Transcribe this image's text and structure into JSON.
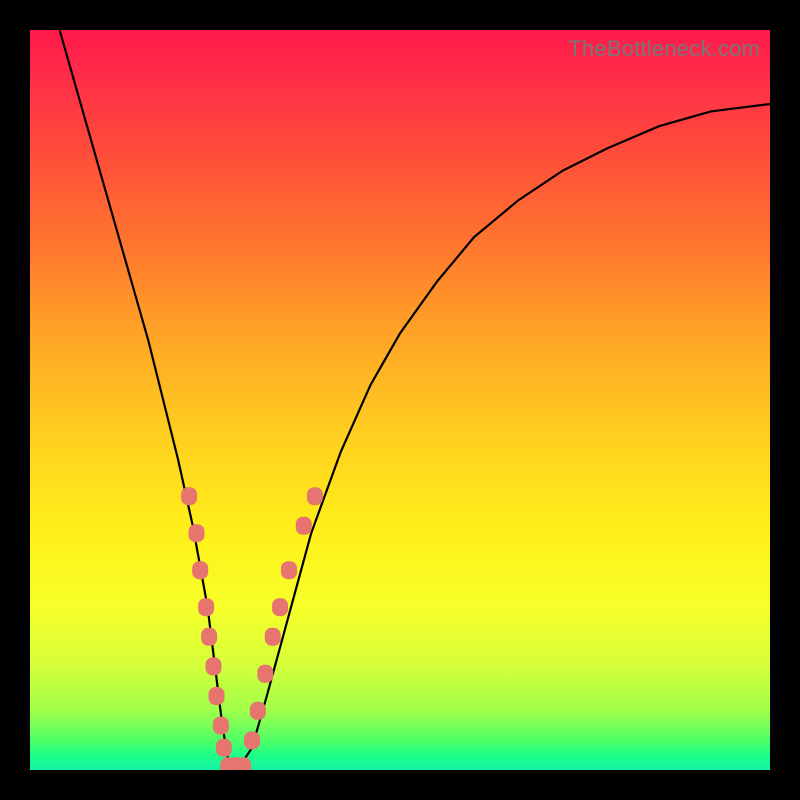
{
  "watermark": "TheBottleneck.com",
  "chart_data": {
    "type": "line",
    "title": "",
    "xlabel": "",
    "ylabel": "",
    "xlim": [
      0,
      100
    ],
    "ylim": [
      0,
      100
    ],
    "grid": false,
    "legend": false,
    "background_gradient": {
      "direction": "top-to-bottom",
      "stops": [
        {
          "pos": 0,
          "color": "#ff1a4b"
        },
        {
          "pos": 18,
          "color": "#ff5138"
        },
        {
          "pos": 42,
          "color": "#ffa726"
        },
        {
          "pos": 68,
          "color": "#fff01a"
        },
        {
          "pos": 86,
          "color": "#d4ff3a"
        },
        {
          "pos": 100,
          "color": "#14f2a8"
        }
      ]
    },
    "series": [
      {
        "name": "bottleneck-curve",
        "color": "#000000",
        "x": [
          4,
          6,
          8,
          10,
          12,
          14,
          16,
          18,
          20,
          22,
          24,
          25,
          26,
          27,
          28,
          30,
          32,
          35,
          38,
          42,
          46,
          50,
          55,
          60,
          66,
          72,
          78,
          85,
          92,
          100
        ],
        "y": [
          100,
          93,
          86,
          79,
          72,
          65,
          58,
          50,
          42,
          33,
          22,
          14,
          6,
          0,
          0,
          3,
          10,
          21,
          32,
          43,
          52,
          59,
          66,
          72,
          77,
          81,
          84,
          87,
          89,
          90
        ]
      }
    ],
    "markers": [
      {
        "name": "left-branch-dots",
        "color": "#e6756f",
        "shape": "rounded-rect",
        "points": [
          {
            "x": 21.5,
            "y": 37
          },
          {
            "x": 22.5,
            "y": 32
          },
          {
            "x": 23.0,
            "y": 27
          },
          {
            "x": 23.8,
            "y": 22
          },
          {
            "x": 24.2,
            "y": 18
          },
          {
            "x": 24.8,
            "y": 14
          },
          {
            "x": 25.2,
            "y": 10
          },
          {
            "x": 25.8,
            "y": 6
          },
          {
            "x": 26.2,
            "y": 3
          }
        ]
      },
      {
        "name": "trough-dots",
        "color": "#e6756f",
        "shape": "rounded-rect",
        "points": [
          {
            "x": 26.8,
            "y": 0.5
          },
          {
            "x": 27.8,
            "y": 0.5
          },
          {
            "x": 28.8,
            "y": 0.5
          }
        ]
      },
      {
        "name": "right-branch-dots",
        "color": "#e6756f",
        "shape": "rounded-rect",
        "points": [
          {
            "x": 30.0,
            "y": 4
          },
          {
            "x": 30.8,
            "y": 8
          },
          {
            "x": 31.8,
            "y": 13
          },
          {
            "x": 32.8,
            "y": 18
          },
          {
            "x": 33.8,
            "y": 22
          },
          {
            "x": 35.0,
            "y": 27
          },
          {
            "x": 37.0,
            "y": 33
          },
          {
            "x": 38.5,
            "y": 37
          }
        ]
      }
    ]
  }
}
